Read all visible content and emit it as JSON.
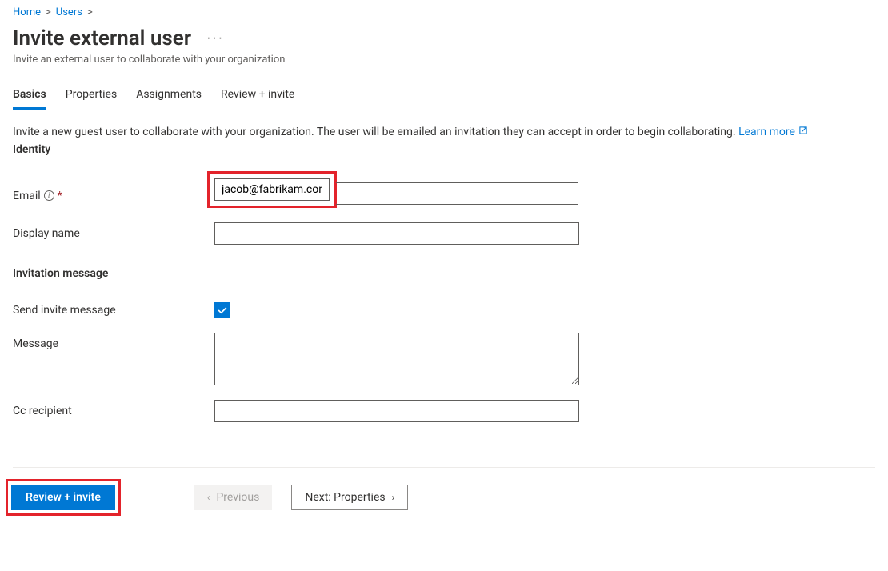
{
  "breadcrumb": {
    "home": "Home",
    "users": "Users"
  },
  "header": {
    "title": "Invite external user",
    "subtitle": "Invite an external user to collaborate with your organization"
  },
  "tabs": {
    "basics": "Basics",
    "properties": "Properties",
    "assignments": "Assignments",
    "review": "Review + invite"
  },
  "intro": {
    "text": "Invite a new guest user to collaborate with your organization. The user will be emailed an invitation they can accept in order to begin collaborating.",
    "learnmore": "Learn more"
  },
  "sections": {
    "identity": "Identity",
    "invitation": "Invitation message"
  },
  "fields": {
    "email_label": "Email",
    "email_value": "jacob@fabrikam.com",
    "display_name_label": "Display name",
    "display_name_value": "",
    "send_invite_label": "Send invite message",
    "message_label": "Message",
    "message_value": "",
    "cc_label": "Cc recipient",
    "cc_value": ""
  },
  "footer": {
    "review_btn": "Review + invite",
    "previous_btn": "Previous",
    "next_btn": "Next: Properties"
  }
}
